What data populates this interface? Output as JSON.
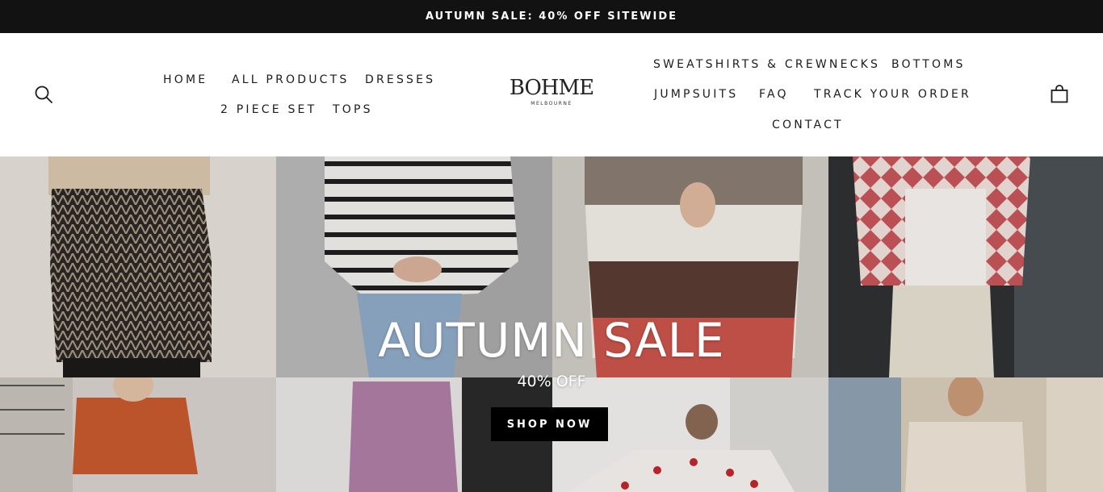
{
  "announcement": {
    "text": "AUTUMN SALE: 40% OFF SITEWIDE"
  },
  "header": {
    "logo_main": "BOHME",
    "logo_sub": "MELBOURNE",
    "nav_left": [
      "HOME",
      "ALL PRODUCTS",
      "DRESSES",
      "2 PIECE SET",
      "TOPS"
    ],
    "nav_right": [
      "SWEATSHIRTS & CREWNECKS",
      "BOTTOMS",
      "JUMPSUITS",
      "FAQ",
      "TRACK YOUR ORDER",
      "CONTACT"
    ],
    "icons": {
      "search": "search-icon",
      "cart": "shopping-bag-icon"
    }
  },
  "hero": {
    "title": "AUTUMN SALE",
    "subtitle": "40% OFF",
    "button_label": "SHOP NOW",
    "tiles": [
      "herringbone-sweater-photo",
      "striped-sweater-photo",
      "colorblock-sweater-photo",
      "quilted-jacket-photo",
      "orange-two-piece-photo",
      "lilac-jumpsuit-photo",
      "heart-cardigan-photo",
      "cream-sweater-photo"
    ]
  },
  "colors": {
    "announcement_bg": "#121212",
    "button_bg": "#000000",
    "text": "#1c1c1c"
  }
}
